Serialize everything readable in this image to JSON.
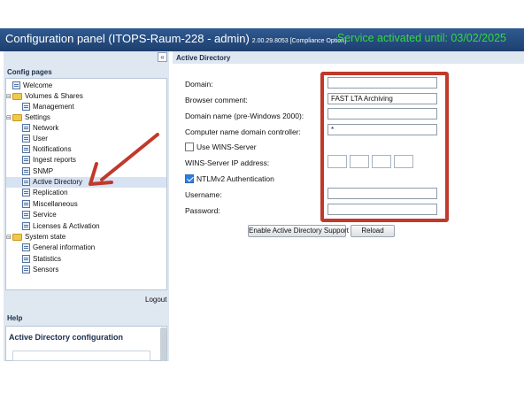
{
  "header": {
    "title": "Configuration panel (ITOPS-Raum-228 - admin)",
    "version": "2.00.29.8053 [Compliance Option]",
    "service_status": "Service activated until: 03/02/2025"
  },
  "sidebar": {
    "collapse_glyph": "«",
    "heading": "Config pages",
    "items": [
      {
        "label": "Welcome",
        "type": "page"
      },
      {
        "label": "Volumes & Shares",
        "type": "folder"
      },
      {
        "label": "Management",
        "type": "page"
      },
      {
        "label": "Settings",
        "type": "folder"
      },
      {
        "label": "Network",
        "type": "page"
      },
      {
        "label": "User",
        "type": "page"
      },
      {
        "label": "Notifications",
        "type": "page"
      },
      {
        "label": "Ingest reports",
        "type": "page"
      },
      {
        "label": "SNMP",
        "type": "page"
      },
      {
        "label": "Active Directory",
        "type": "page",
        "selected": true
      },
      {
        "label": "Replication",
        "type": "page"
      },
      {
        "label": "Miscellaneous",
        "type": "page"
      },
      {
        "label": "Service",
        "type": "page"
      },
      {
        "label": "Licenses & Activation",
        "type": "page"
      },
      {
        "label": "System state",
        "type": "folder"
      },
      {
        "label": "General information",
        "type": "page"
      },
      {
        "label": "Statistics",
        "type": "page"
      },
      {
        "label": "Sensors",
        "type": "page"
      }
    ],
    "logout": "Logout"
  },
  "help": {
    "heading": "Help",
    "title": "Active Directory configuration"
  },
  "main": {
    "heading": "Active Directory",
    "fields": {
      "domain_label": "Domain:",
      "domain_value": "",
      "browser_comment_label": "Browser comment:",
      "browser_comment_value": "FAST LTA Archiving",
      "domain_name_label": "Domain name (pre-Windows 2000):",
      "domain_name_value": "",
      "dc_label": "Computer name domain controller:",
      "dc_value": "*",
      "wins_label": "Use WINS-Server",
      "wins_checked": false,
      "wins_ip_label": "WINS-Server IP address:",
      "ntlm_label": "NTLMv2 Authentication",
      "ntlm_checked": true,
      "username_label": "Username:",
      "username_value": "",
      "password_label": "Password:",
      "password_value": ""
    },
    "buttons": {
      "enable": "Enable Active Directory Support",
      "reload": "Reload"
    }
  },
  "annotations": {
    "highlight_color": "#c0392b",
    "arrow_color": "#c0392b"
  }
}
